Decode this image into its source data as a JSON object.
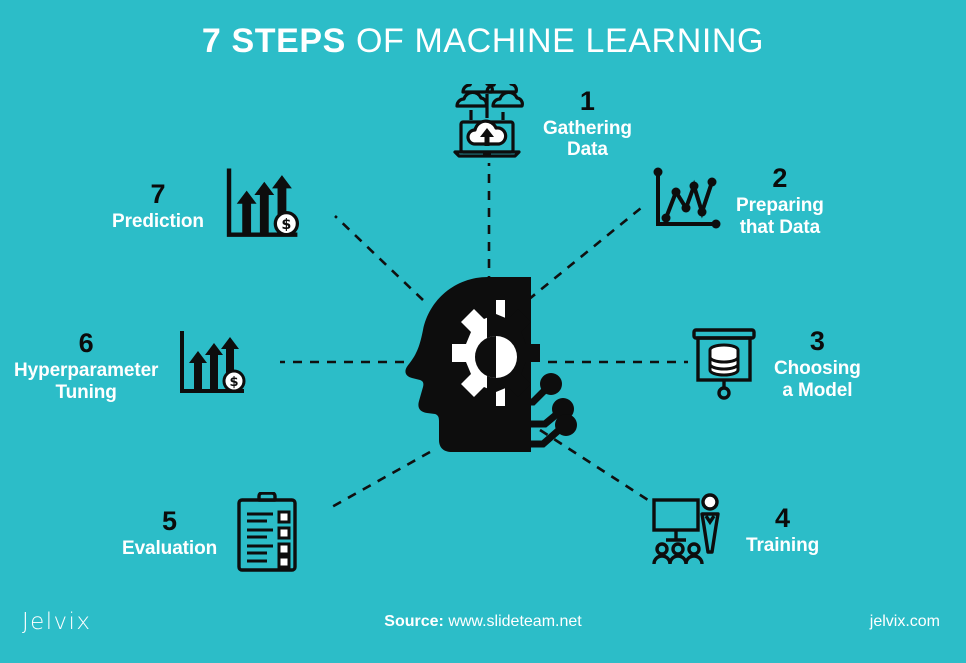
{
  "title": {
    "bold_part": "7 STEPS",
    "rest_part": " OF MACHINE LEARNING"
  },
  "center": {
    "icon": "head-gear-circuit-icon"
  },
  "steps": [
    {
      "number": "1",
      "label": "Gathering\nData",
      "icon": "cloud-upload-laptop-icon"
    },
    {
      "number": "2",
      "label": "Preparing\nthat Data",
      "icon": "line-chart-icon"
    },
    {
      "number": "3",
      "label": "Choosing\na Model",
      "icon": "presentation-database-icon"
    },
    {
      "number": "4",
      "label": "Training",
      "icon": "whiteboard-teacher-audience-icon"
    },
    {
      "number": "5",
      "label": "Evaluation",
      "icon": "clipboard-checklist-icon"
    },
    {
      "number": "6",
      "label": "Hyperparameter\nTuning",
      "icon": "growth-arrows-coin-icon"
    },
    {
      "number": "7",
      "label": "Prediction",
      "icon": "growth-arrows-coin-icon"
    }
  ],
  "footer": {
    "logo": "Jelvix",
    "source_label": "Source:",
    "source_url": "www.slideteam.net",
    "website": "jelvix.com"
  },
  "colors": {
    "background": "#2cbdc8",
    "ink": "#0b0b0b",
    "text_on_bg": "#ffffff"
  }
}
